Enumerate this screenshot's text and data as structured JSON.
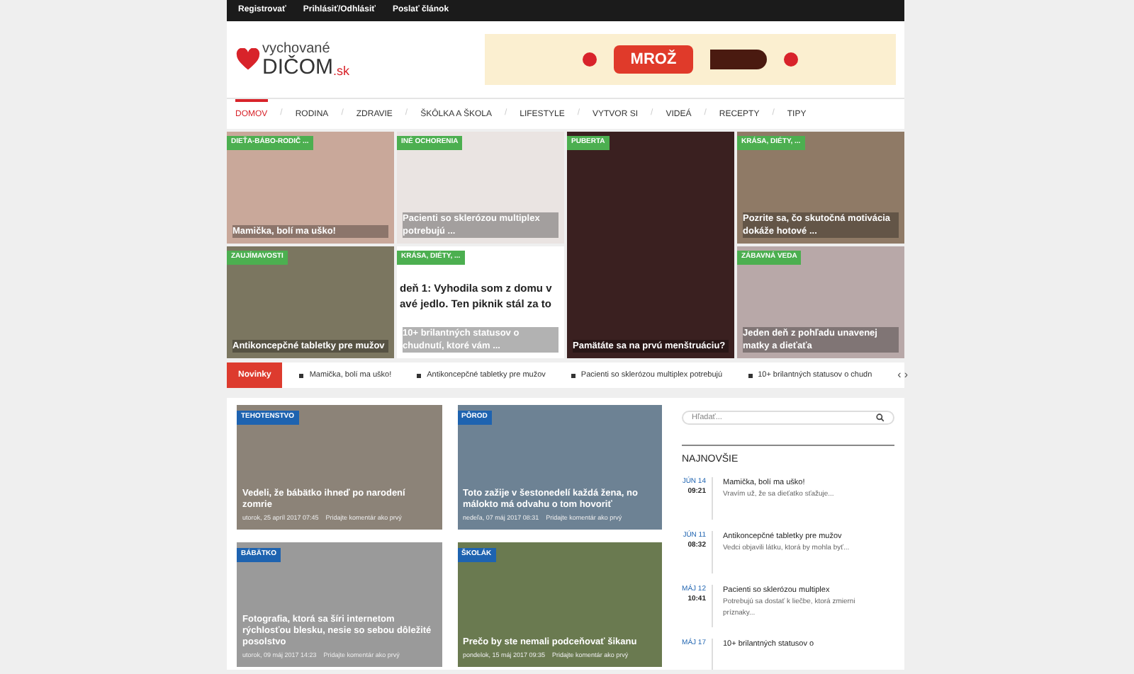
{
  "top_bar": {
    "links": [
      "Registrovať",
      "Prihlásiť/Odhlásiť",
      "Poslať článok"
    ]
  },
  "logo": {
    "top": "vychované",
    "main": "DIČOM",
    "suffix": ".sk"
  },
  "ad": {
    "text": "MROŽ"
  },
  "nav": [
    {
      "label": "DOMOV",
      "selected": true
    },
    {
      "separator": "/",
      "label": "RODINA",
      "selected": false
    },
    {
      "separator": "/",
      "label": "ZDRAVIE",
      "selected": false
    },
    {
      "separator": "/",
      "label": "ŠKÔLKA A ŠKOLA",
      "selected": false
    },
    {
      "separator": "/",
      "label": "LIFESTYLE",
      "selected": false
    },
    {
      "separator": "/",
      "label": "VYTVOR SI",
      "selected": false
    },
    {
      "separator": "/",
      "label": "VIDEÁ",
      "selected": false
    },
    {
      "separator": "/",
      "label": "RECEPTY",
      "selected": false
    },
    {
      "separator": "/",
      "label": "TIPY",
      "selected": false
    }
  ],
  "featured": [
    {
      "kind": "normal",
      "category": "DIEŤA-BÁBO-RODIČ ...",
      "title": "Mamička, bolí ma uško!"
    },
    {
      "kind": "normal",
      "category": "INÉ OCHORENIA",
      "title": "Pacienti so sklerózou multiplex potrebujú ..."
    },
    {
      "kind": "tall",
      "category": "PUBERTA",
      "title": "Pamätáte sa na prvú menštruáciu?"
    },
    {
      "kind": "normal",
      "category": "KRÁSA, DIÉTY, ...",
      "title": "Pozrite sa, čo skutočná motivácia dokáže hotové ..."
    },
    {
      "kind": "normal",
      "category": "ZAUJÍMAVOSTI",
      "title": "Antikoncepčné tabletky pre mužov"
    },
    {
      "kind": "post",
      "category": "KRÁSA, DIÉTY, ...",
      "title": "10+ brilantných statusov o chudnutí, ktoré vám ...",
      "post_lines": [
        "deň 1: Vyhodila som z domu v",
        "avé jedlo. Ten piknik stál za to"
      ]
    },
    {
      "kind": "normal",
      "category": "ZÁBAVNÁ VEDA",
      "title": "Jeden deň z pohľadu unavenej matky a dieťaťa"
    }
  ],
  "ticker": {
    "label": "Novinky",
    "items": [
      "Mamička, bolí ma uško!",
      "Antikoncepčné tabletky pre mužov",
      "Pacienti so sklerózou multiplex potrebujú",
      "10+ brilantných statusov o chudn"
    ],
    "prev": "‹",
    "next": "›"
  },
  "articles": [
    {
      "category": "TEHOTENSTVO",
      "title": "Vedeli, že bábätko ihneď po narodení zomrie",
      "date": "utorok, 25 apríl 2017 07:45",
      "comments": "Pridajte komentár ako prvý"
    },
    {
      "category": "PÔROD",
      "title": "Toto zažije v šestonedelí každá žena, no málokto má odvahu o tom hovoriť",
      "date": "nedeľa, 07 máj 2017 08:31",
      "comments": "Pridajte komentár ako prvý"
    },
    {
      "category": "BÁBÄTKO",
      "title": "Fotografia, ktorá sa šíri internetom rýchlosťou blesku, nesie so sebou dôležité posolstvo",
      "date": "utorok, 09 máj 2017 14:23",
      "comments": "Pridajte komentár ako prvý"
    },
    {
      "category": "ŠKOLÁK",
      "title": "Prečo by ste nemali podceňovať šikanu",
      "date": "pondelok, 15 máj 2017 09:35",
      "comments": "Pridajte komentár ako prvý"
    }
  ],
  "sidebar": {
    "search": {
      "placeholder": "Hľadať..."
    },
    "heading": "NAJNOVŠIE",
    "items": [
      {
        "month": "JÚN 14",
        "time": "09:21",
        "title": "Mamička, bolí ma uško!",
        "excerpt": "Vravím už, že sa dieťatko sťažuje..."
      },
      {
        "month": "JÚN 11",
        "time": "08:32",
        "title": "Antikoncepčné tabletky pre mužov",
        "excerpt": "Vedci objavili látku, ktorá by mohla byť..."
      },
      {
        "month": "MÁJ 12",
        "time": "10:41",
        "title": "Pacienti so sklerózou multiplex",
        "excerpt": "Potrebujú sa dostať k liečbe, ktorá zmierni príznaky..."
      },
      {
        "month": "MÁJ 17",
        "title": "10+ brilantných statusov o"
      }
    ]
  }
}
